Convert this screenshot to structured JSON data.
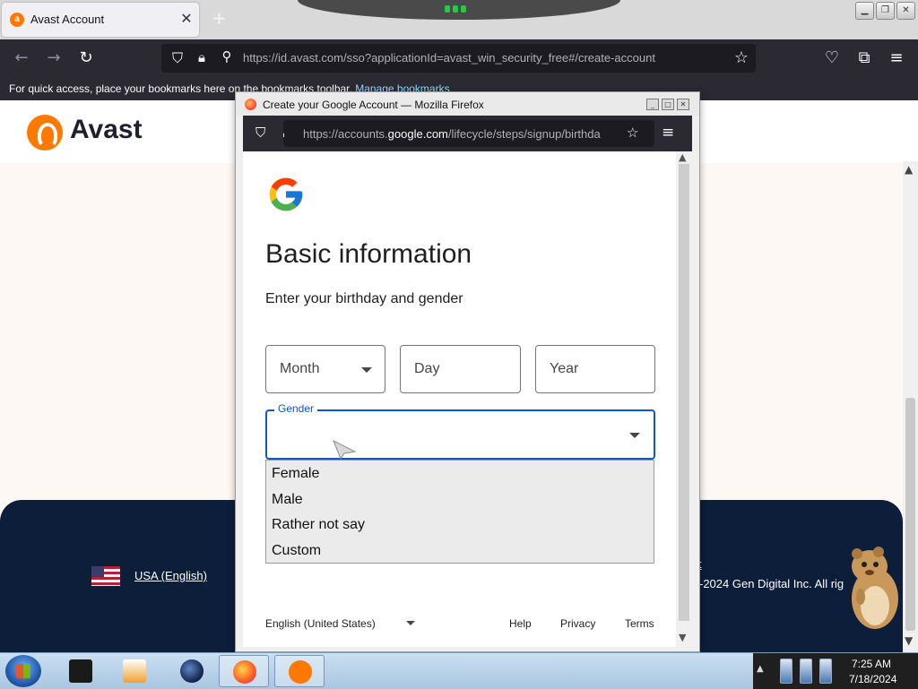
{
  "browser": {
    "tab_title": "Avast Account",
    "tab_close": "✕",
    "new_tab": "+",
    "url_host": "https://id.avast.com",
    "url_path": "/sso?applicationId=avast_win_security_free#/create-account",
    "bookmarks_text": "For quick access, place your bookmarks here on the bookmarks toolbar.",
    "bookmarks_link": "Manage bookmarks"
  },
  "avast": {
    "logo_text": "Avast",
    "footer_language": "USA (English)",
    "footer_copyright": "-2024 Gen Digital Inc. All rig",
    "footer_link_fragment": "it"
  },
  "popup": {
    "window_title": "Create your Google Account — Mozilla Firefox",
    "url_prefix": "https://accounts.",
    "url_host": "google.com",
    "url_path": "/lifecycle/steps/signup/birthda",
    "heading": "Basic information",
    "subheading": "Enter your birthday and gender",
    "month_label": "Month",
    "day_label": "Day",
    "year_label": "Year",
    "gender_label": "Gender",
    "gender_value": "",
    "gender_options": [
      "Female",
      "Male",
      "Rather not say",
      "Custom"
    ],
    "footer": {
      "language": "English (United States)",
      "help": "Help",
      "privacy": "Privacy",
      "terms": "Terms"
    }
  },
  "taskbar": {
    "time": "7:25 AM",
    "date": "7/18/2024"
  },
  "colors": {
    "google_blue": "#0b57d0",
    "avast_orange": "#ff7800",
    "avast_navy": "#0c1e3a"
  }
}
